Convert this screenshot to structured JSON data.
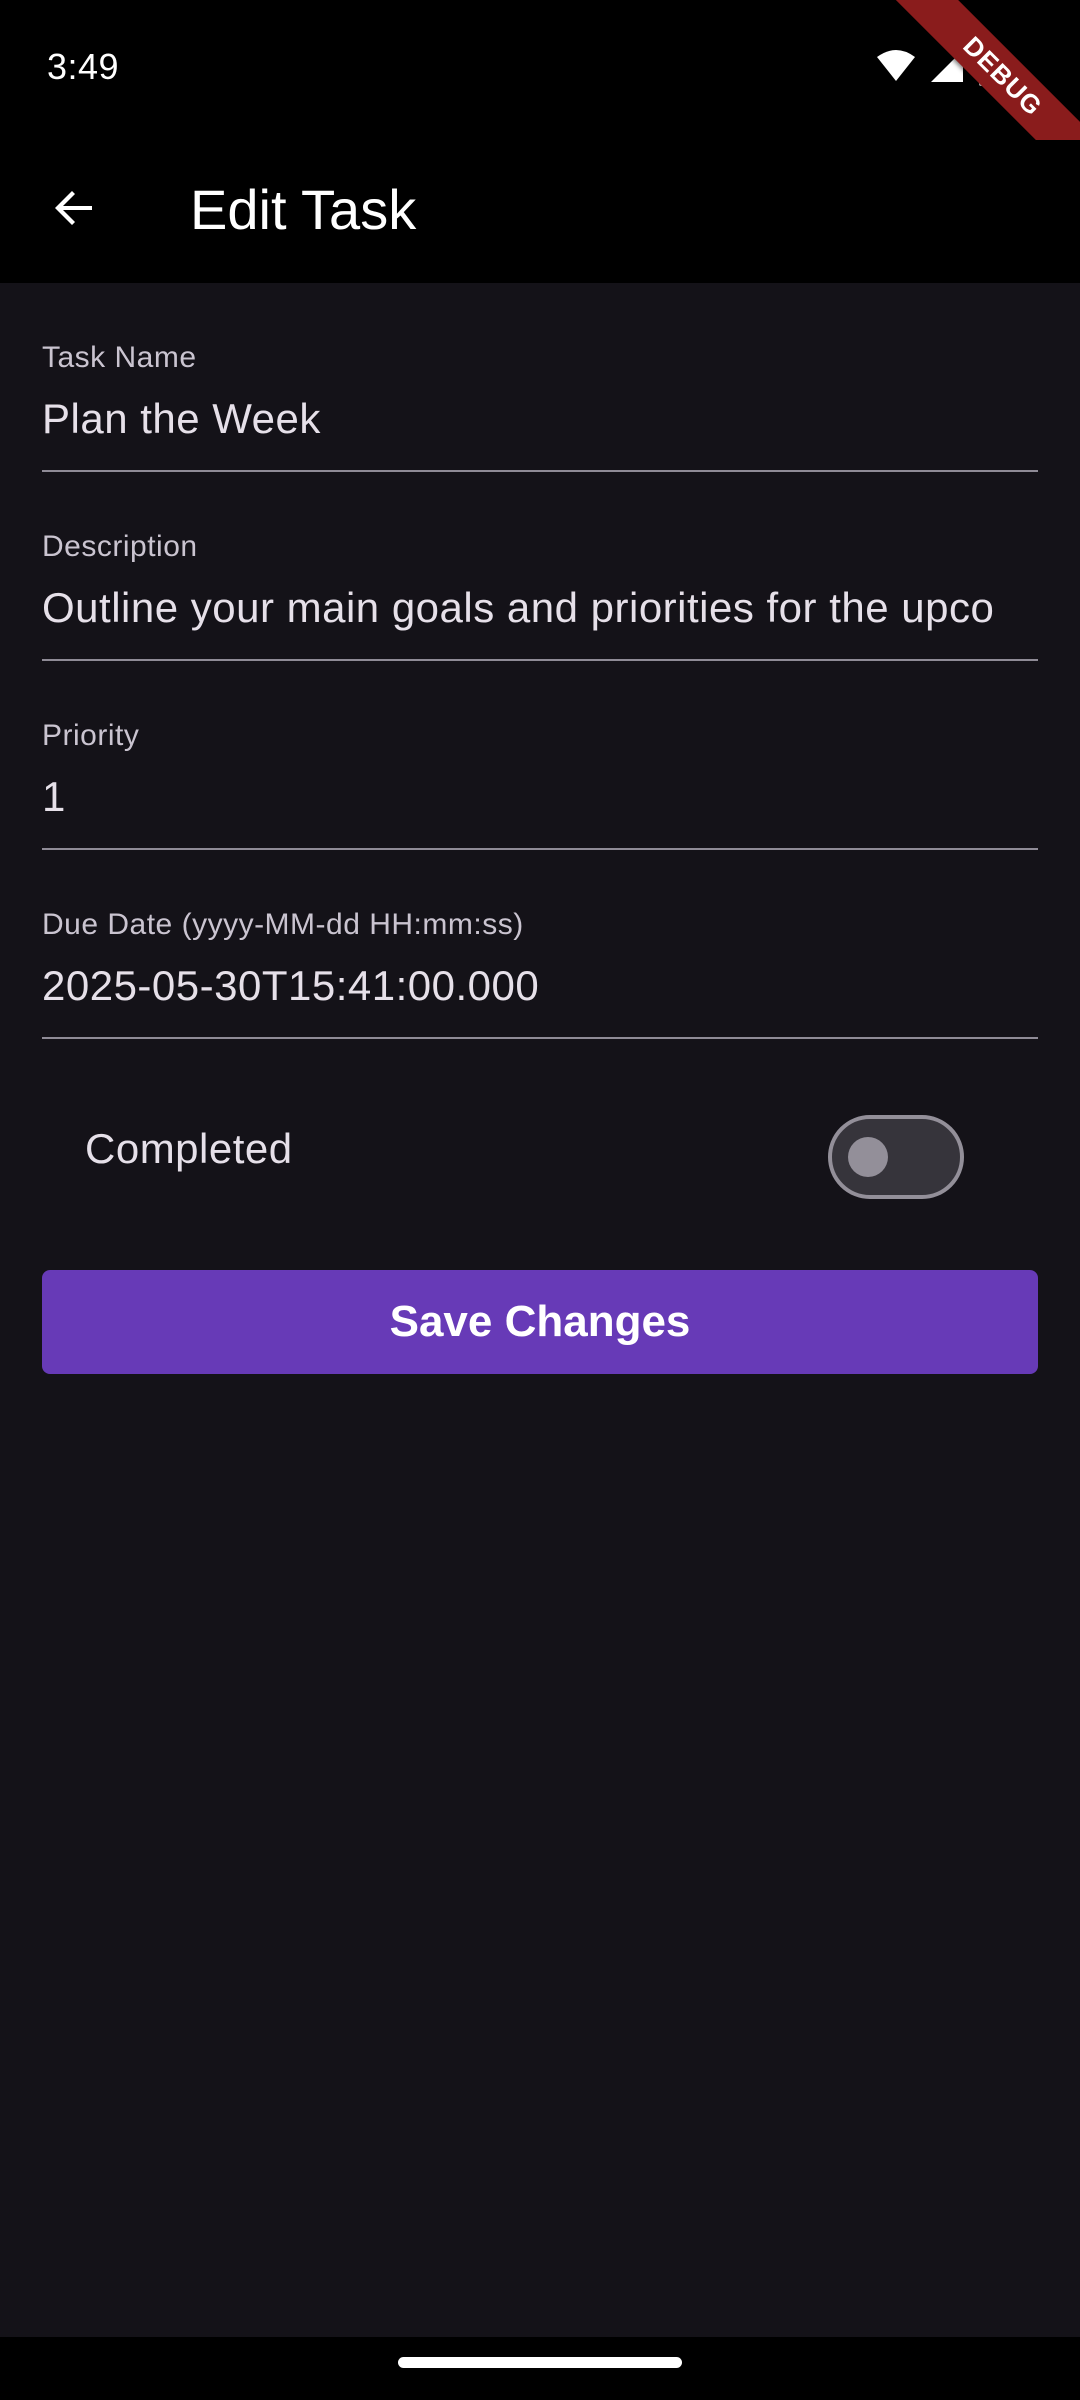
{
  "status_bar": {
    "time": "3:49",
    "icons": [
      "wifi-icon",
      "cell-signal-icon",
      "battery-icon"
    ]
  },
  "debug_banner": "DEBUG",
  "app_bar": {
    "title": "Edit Task",
    "back_icon": "arrow-back-icon"
  },
  "form": {
    "task_name": {
      "label": "Task Name",
      "value": "Plan the Week"
    },
    "description": {
      "label": "Description",
      "value": "Outline your main goals and priorities for the upco"
    },
    "priority": {
      "label": "Priority",
      "value": "1"
    },
    "due_date": {
      "label": "Due Date (yyyy-MM-dd HH:mm:ss)",
      "value": "2025-05-30T15:41:00.000"
    },
    "completed": {
      "label": "Completed",
      "checked": false
    }
  },
  "save_button": {
    "label": "Save Changes"
  },
  "colors": {
    "background": "#141218",
    "app_bar": "#000000",
    "primary_button": "#673ab7",
    "debug_banner": "#8a1c1c",
    "divider": "#8f8b96"
  }
}
